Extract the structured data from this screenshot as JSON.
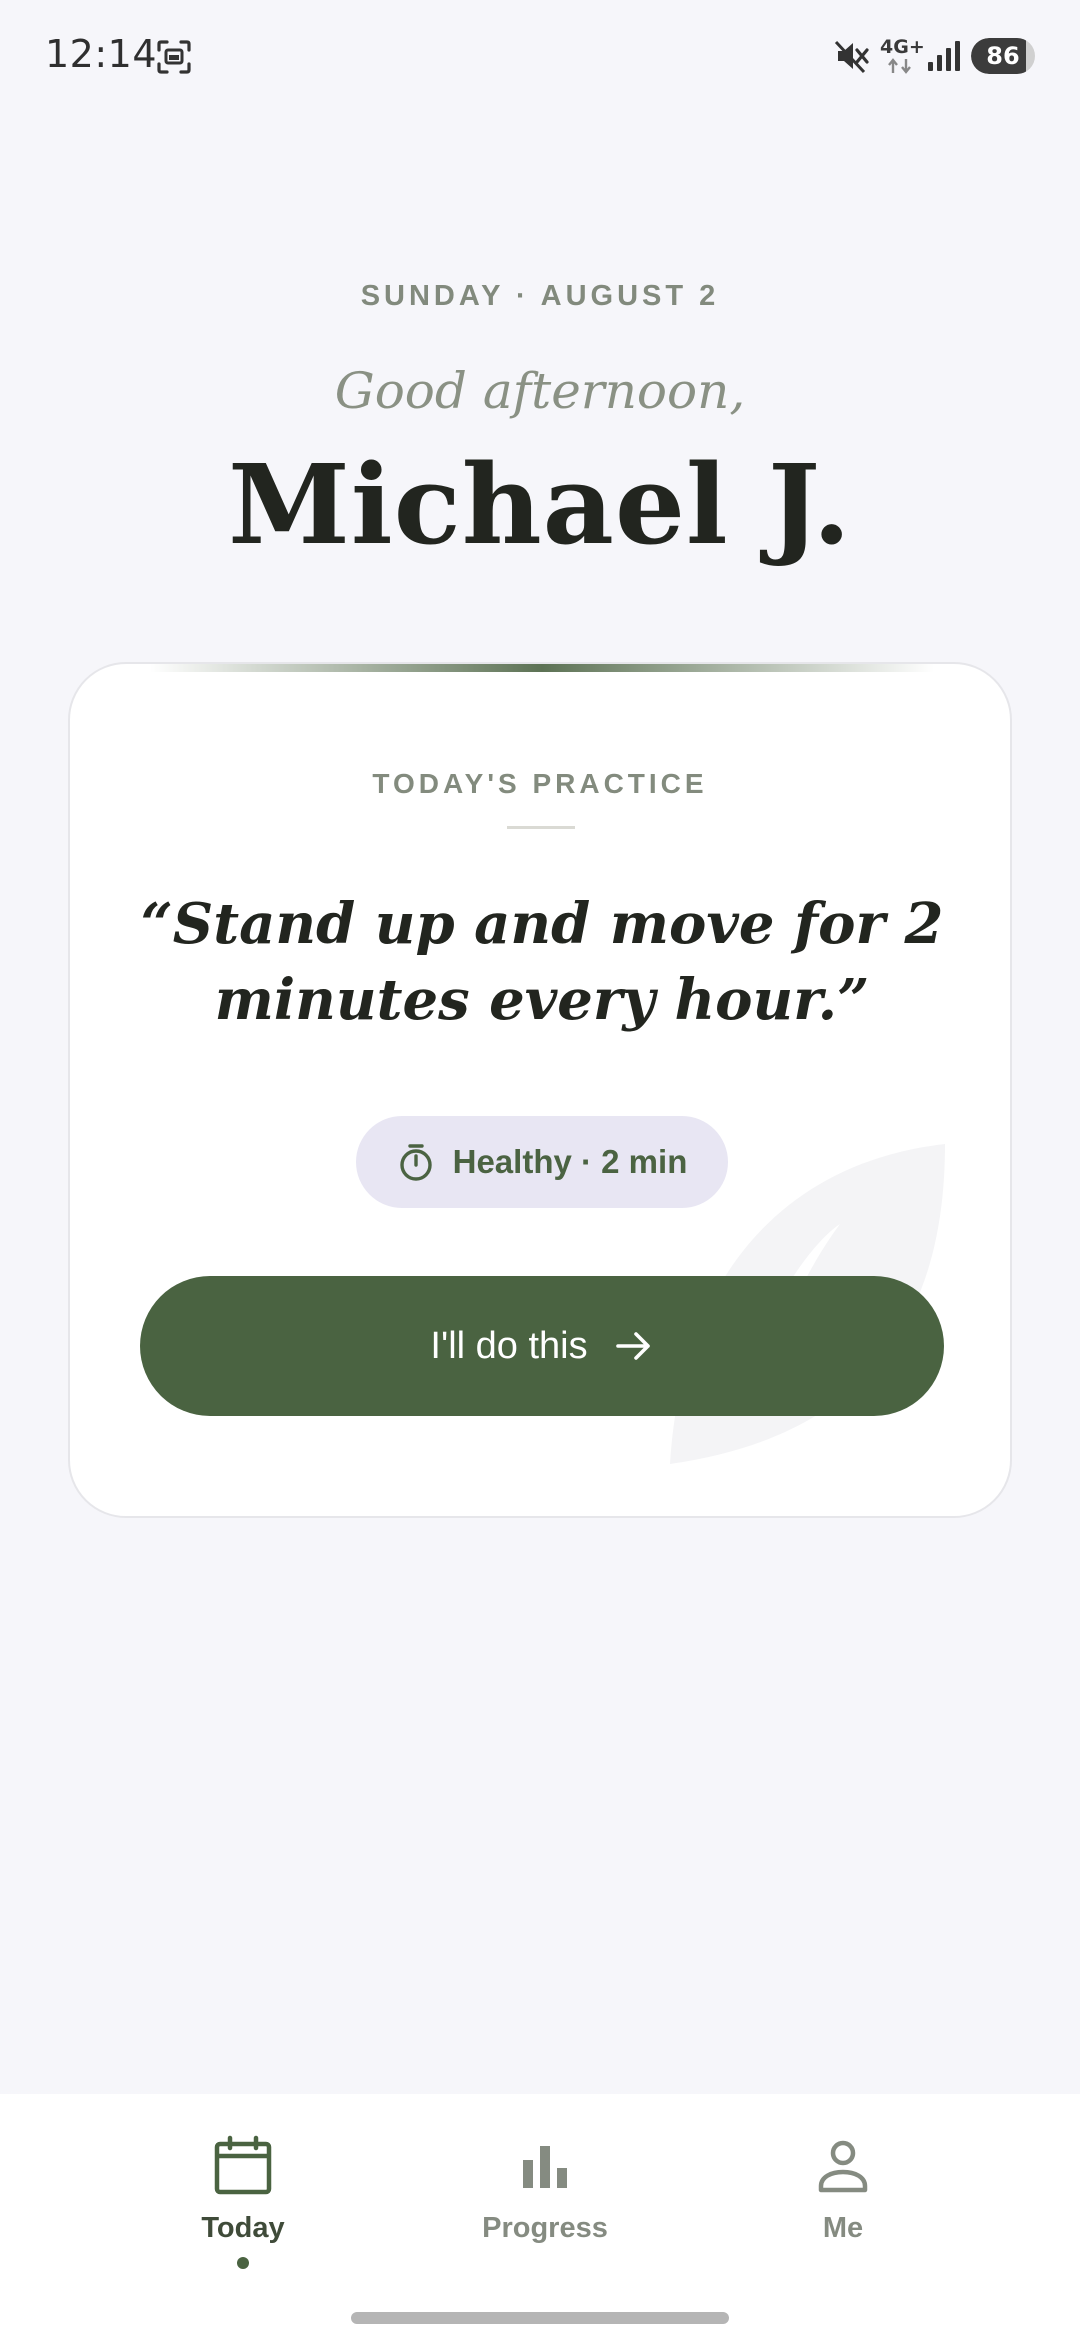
{
  "status_bar": {
    "time": "12:14",
    "network": "4G+",
    "battery_level": "86",
    "battery_fraction": 0.86
  },
  "header": {
    "date": "SUNDAY · AUGUST 2",
    "greeting": "Good afternoon,",
    "name": "Michael J."
  },
  "practice_card": {
    "label": "TODAY'S PRACTICE",
    "quote": "“Stand up and move for 2 minutes every hour.”",
    "chip_text": "Healthy · 2 min",
    "chip_icon": "stopwatch-icon",
    "button_label": "I'll do this",
    "button_icon": "arrow-right-icon"
  },
  "bottom_nav": {
    "items": [
      {
        "label": "Today",
        "icon": "calendar-icon",
        "active": true
      },
      {
        "label": "Progress",
        "icon": "bar-chart-icon",
        "active": false
      },
      {
        "label": "Me",
        "icon": "person-icon",
        "active": false
      }
    ]
  },
  "colors": {
    "background": "#f6f6fa",
    "accent_green": "#4a6341",
    "chip_background": "#e8e6f3",
    "muted_text": "#828a7d",
    "dark_text": "#22251f"
  }
}
